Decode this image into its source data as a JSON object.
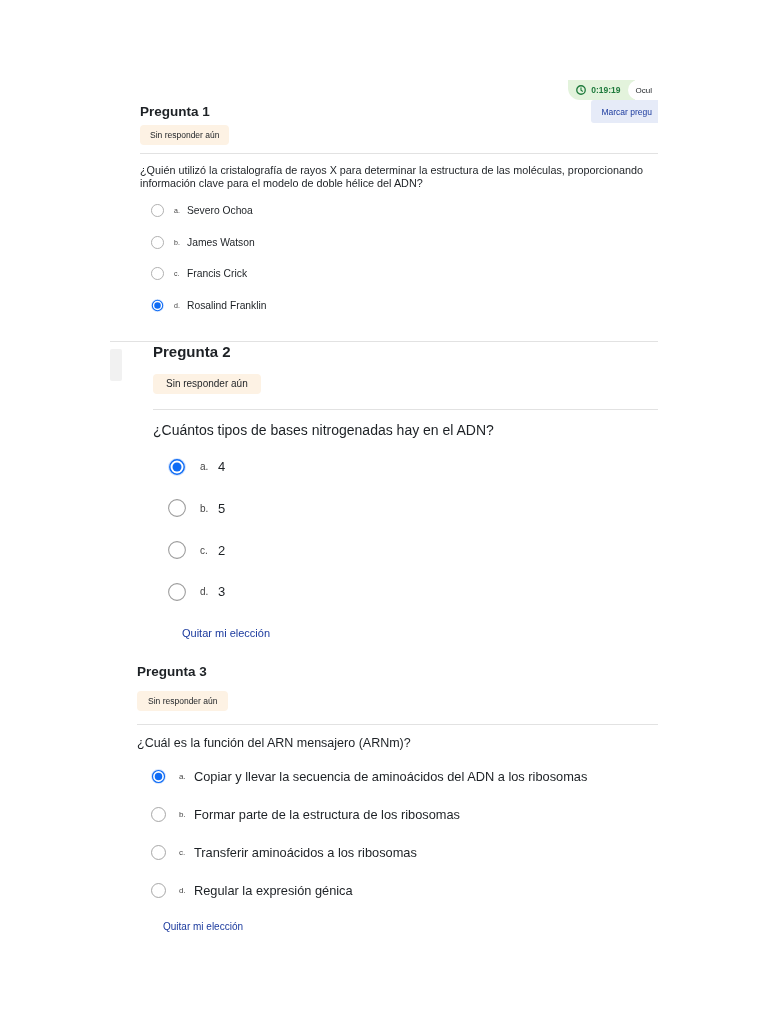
{
  "timer": {
    "time": "0:19:19",
    "hide_button": "Ocul"
  },
  "questions": [
    {
      "title": "Pregunta 1",
      "flag_button": "Marcar pregu",
      "status": "Sin responder aún",
      "text": "¿Quién utilizó la cristalografía de rayos X para determinar la estructura de las moléculas, proporcionando información clave para el modelo de doble hélice del ADN?",
      "options": [
        {
          "letter": "a.",
          "text": "Severo Ochoa",
          "selected": false
        },
        {
          "letter": "b.",
          "text": "James Watson",
          "selected": false
        },
        {
          "letter": "c.",
          "text": "Francis Crick",
          "selected": false
        },
        {
          "letter": "d.",
          "text": "Rosalind Franklin",
          "selected": true
        }
      ]
    },
    {
      "title": "Pregunta 2",
      "status": "Sin responder aún",
      "text": "¿Cuántos tipos de bases nitrogenadas hay en el ADN?",
      "options": [
        {
          "letter": "a.",
          "text": "4",
          "selected": true
        },
        {
          "letter": "b.",
          "text": "5",
          "selected": false
        },
        {
          "letter": "c.",
          "text": "2",
          "selected": false
        },
        {
          "letter": "d.",
          "text": "3",
          "selected": false
        }
      ],
      "clear_choice": "Quitar mi elección"
    },
    {
      "title": "Pregunta 3",
      "status": "Sin responder aún",
      "text": "¿Cuál es la función del ARN mensajero (ARNm)?",
      "options": [
        {
          "letter": "a.",
          "text": "Copiar y llevar la secuencia de aminoácidos del ADN a los ribosomas",
          "selected": true
        },
        {
          "letter": "b.",
          "text": "Formar parte de la estructura de los ribosomas",
          "selected": false
        },
        {
          "letter": "c.",
          "text": "Transferir aminoácidos a los ribosomas",
          "selected": false
        },
        {
          "letter": "d.",
          "text": "Regular la expresión génica",
          "selected": false
        }
      ],
      "clear_choice": "Quitar mi elección"
    }
  ]
}
